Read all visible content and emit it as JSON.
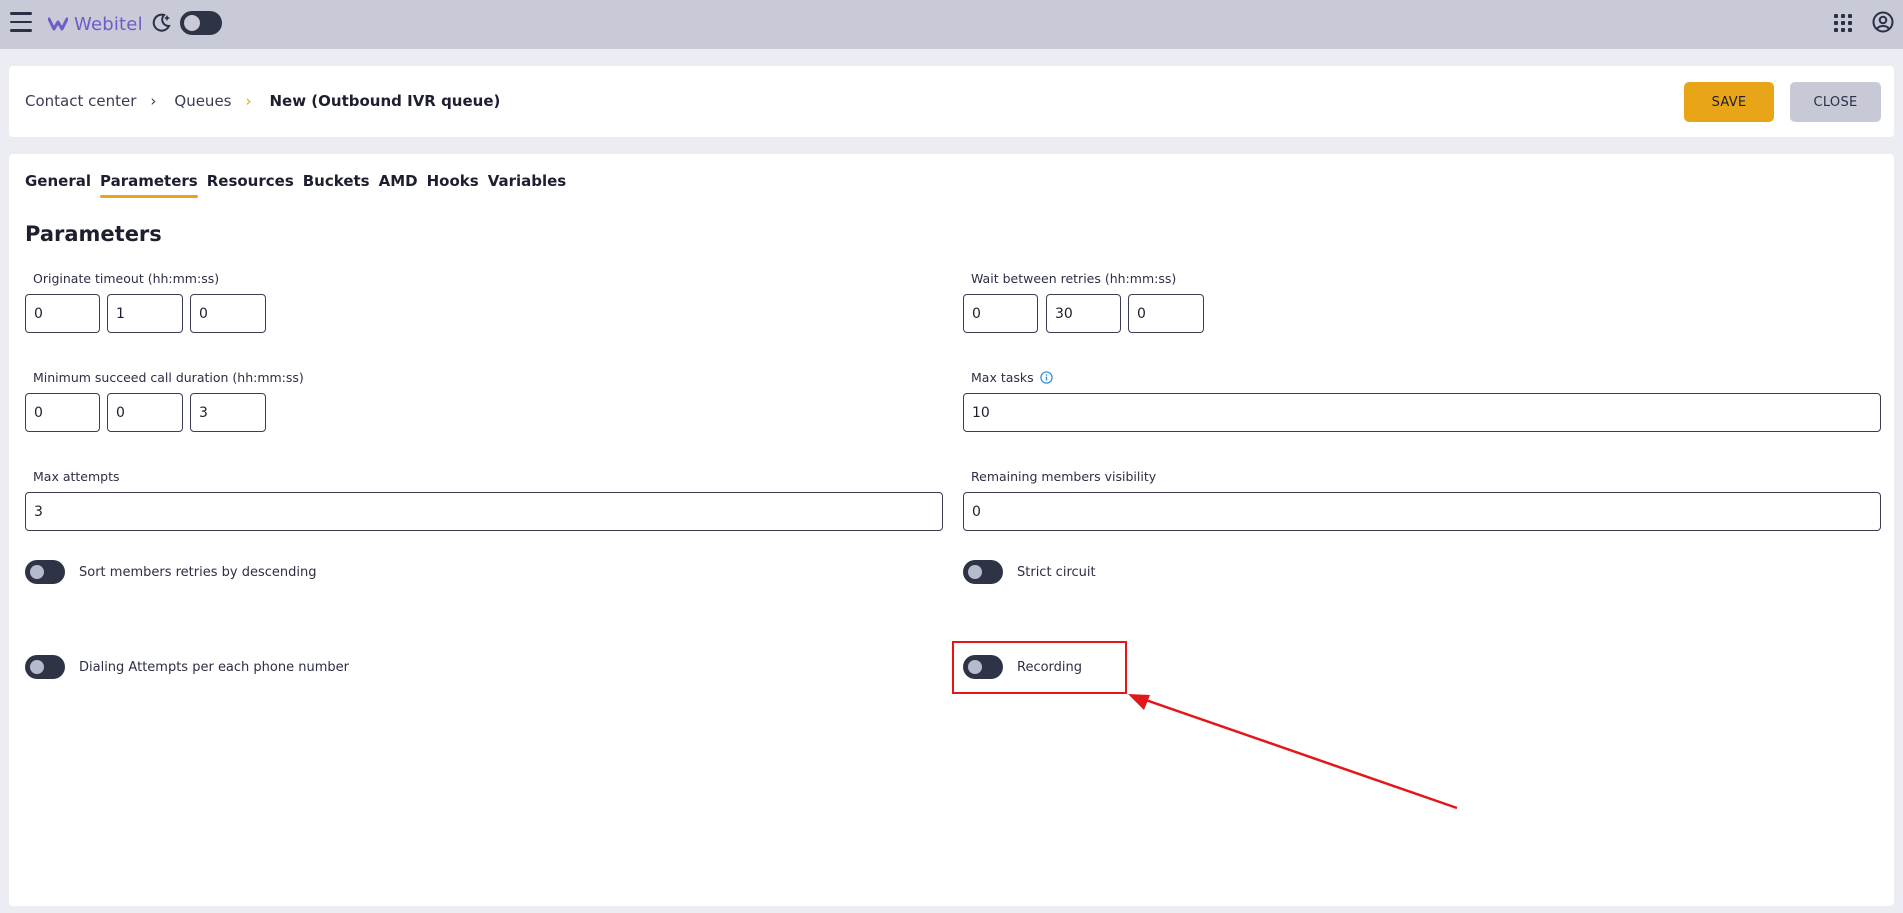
{
  "topbar": {
    "logo_text": "Webitel",
    "icons": [
      "menu-icon",
      "webitel-logo-icon",
      "moon-icon",
      "apps-grid-icon",
      "account-icon"
    ],
    "theme_toggle_on": false
  },
  "header": {
    "breadcrumb": [
      "Contact center",
      "Queues",
      "New (Outbound IVR queue)"
    ],
    "save_label": "SAVE",
    "close_label": "CLOSE"
  },
  "tabs": [
    "General",
    "Parameters",
    "Resources",
    "Buckets",
    "AMD",
    "Hooks",
    "Variables"
  ],
  "active_tab": "Parameters",
  "section_title": "Parameters",
  "fields": {
    "originate_timeout": {
      "label": "Originate timeout (hh:mm:ss)",
      "hh": "0",
      "mm": "1",
      "ss": "0"
    },
    "wait_between_retries": {
      "label": "Wait between retries (hh:mm:ss)",
      "hh": "0",
      "mm": "30",
      "ss": "0"
    },
    "min_call_duration": {
      "label": "Minimum succeed call duration (hh:mm:ss)",
      "hh": "0",
      "mm": "0",
      "ss": "3"
    },
    "max_tasks": {
      "label": "Max tasks",
      "value": "10"
    },
    "max_attempts": {
      "label": "Max attempts",
      "value": "3"
    },
    "remaining_members": {
      "label": "Remaining members visibility",
      "value": "0"
    }
  },
  "toggles": {
    "sort_members": "Sort members retries by descending",
    "strict_circuit": "Strict circuit",
    "dialing_attempts": "Dialing Attempts per each phone number",
    "recording": "Recording"
  },
  "colors": {
    "accent": "#e8a517",
    "annotation": "#e3161a",
    "topbar": "#c8cad7"
  }
}
